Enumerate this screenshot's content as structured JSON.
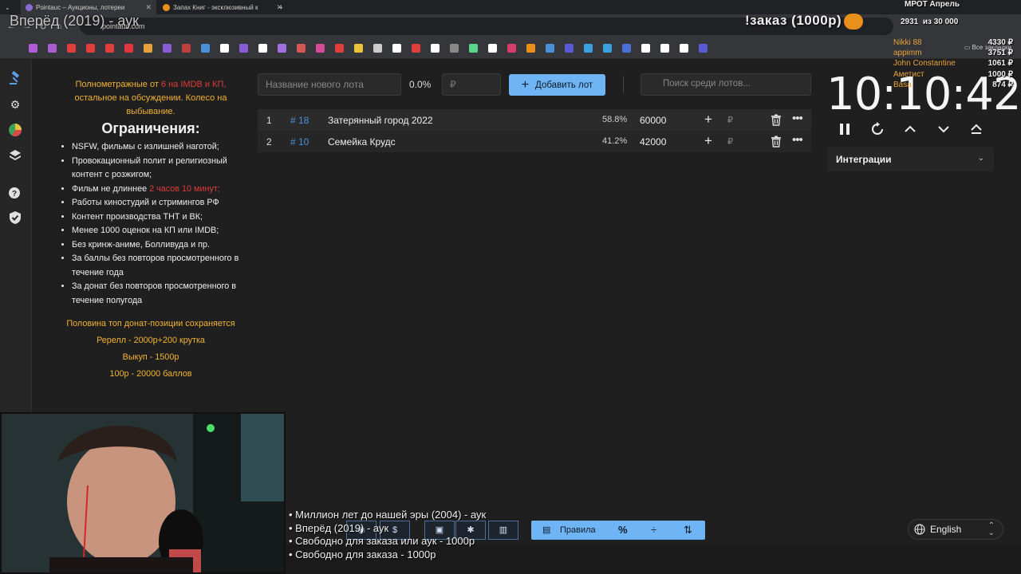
{
  "browser": {
    "tabs": [
      {
        "title": "Pointauc – Аукционы, лотереи"
      },
      {
        "title": "Запах Книг - эксклюзивный к"
      }
    ],
    "address": "pointauc.com",
    "all_bookmarks_label": "Все закладки",
    "bookmark_colors": [
      "#b05cd6",
      "#a95ed0",
      "#e23d3d",
      "#e23d3d",
      "#e23d3d",
      "#e2353d",
      "#e8a23b",
      "#8a5bd6",
      "#c04040",
      "#4a8fd8",
      "#ffffff",
      "#8a5bd6",
      "#ffffff",
      "#a070e0",
      "#d65656",
      "#d64a9a",
      "#e23d3d",
      "#e8c23b",
      "#cccccc",
      "#ffffff",
      "#e23d3d",
      "#ffffff",
      "#888888",
      "#5ad68a",
      "#ffffff",
      "#d63d6a",
      "#e8901a",
      "#4a8fd8",
      "#5a5ad6",
      "#3aa0e0",
      "#3aa0e0",
      "#4a6fd6",
      "#ffffff",
      "#ffffff",
      "#ffffff",
      "#5a5ad6"
    ]
  },
  "overlay": {
    "now_playing": "Вперёд (2019) - аук",
    "order_banner": "!заказ (1000р)",
    "mrot_label": "МРОТ Апрель",
    "mrot_progress_value": "2931",
    "mrot_progress_of": "из 30 000",
    "donors": [
      {
        "name": "Nikki 88",
        "amount": "4330 ₽"
      },
      {
        "name": "appimm",
        "amount": "3751 ₽"
      },
      {
        "name": "John Constantine",
        "amount": "1061 ₽"
      },
      {
        "name": "Аметист",
        "amount": "1000 ₽"
      },
      {
        "name": "Basa",
        "amount": "874 ₽"
      }
    ],
    "ticker": [
      "• Миллион лет до нашей эры (2004) - аук",
      "• Вперёд (2019) - аук",
      "• Свободно для заказа или аук - 1000р",
      "• Свободно для заказа - 1000р"
    ]
  },
  "sidebar": {
    "icons": [
      "gavel-icon",
      "settings-icon",
      "chart-pie-icon",
      "layers-icon",
      "help-icon",
      "shield-icon"
    ],
    "active_index": 0
  },
  "rules": {
    "intro_part1": "Полнометражные от",
    "intro_red": "6 на IMDB и КП,",
    "intro_part2": "остальное на обсуждении. Колесо на выбывание.",
    "heading": "Ограничения:",
    "items": [
      "NSFW, фильмы с излишней наготой;",
      "Провокационный полит и религиозный контент с розжигом;",
      "Фильм не длиннее",
      "Работы киностудий и стримингов РФ",
      "Контент производства ТНТ и ВК;",
      "Менее 1000 оценок на КП или IMDB;",
      "Без кринж-аниме, Болливуда и пр.",
      "За баллы без повторов просмотренного в течение года",
      "За донат без повторов просмотренного в течение полугода"
    ],
    "item3_red": "2 часов 10 минут;",
    "footer": [
      "Половина топ донат-позиции сохраняется",
      "Ререлл - 2000р+200 крутка",
      "Выкуп - 1500р",
      "100р - 20000 баллов"
    ]
  },
  "lot_form": {
    "name_placeholder": "Название нового лота",
    "percent": "0.0%",
    "price_placeholder": "₽",
    "add_button": "Добавить лот",
    "search_placeholder": "Поиск среди лотов..."
  },
  "lots": [
    {
      "index": "1",
      "id": "# 18",
      "name": "Затерянный город 2022",
      "percent": "58.8%",
      "amount": "60000",
      "currency": "₽"
    },
    {
      "index": "2",
      "id": "# 10",
      "name": "Семейка Крудс",
      "percent": "41.2%",
      "amount": "42000",
      "currency": "₽"
    }
  ],
  "timer": {
    "display": "10:10:42",
    "integrations_label": "Интеграции"
  },
  "toolbar": {
    "rules_button": "Правила",
    "percent_button": "%",
    "language": "English"
  },
  "colors": {
    "accent": "#6fb4f5",
    "rules_text": "#f2b233",
    "rules_red": "#e03a3a",
    "lot_id": "#4a8fd8",
    "background": "#1f1f1f"
  }
}
